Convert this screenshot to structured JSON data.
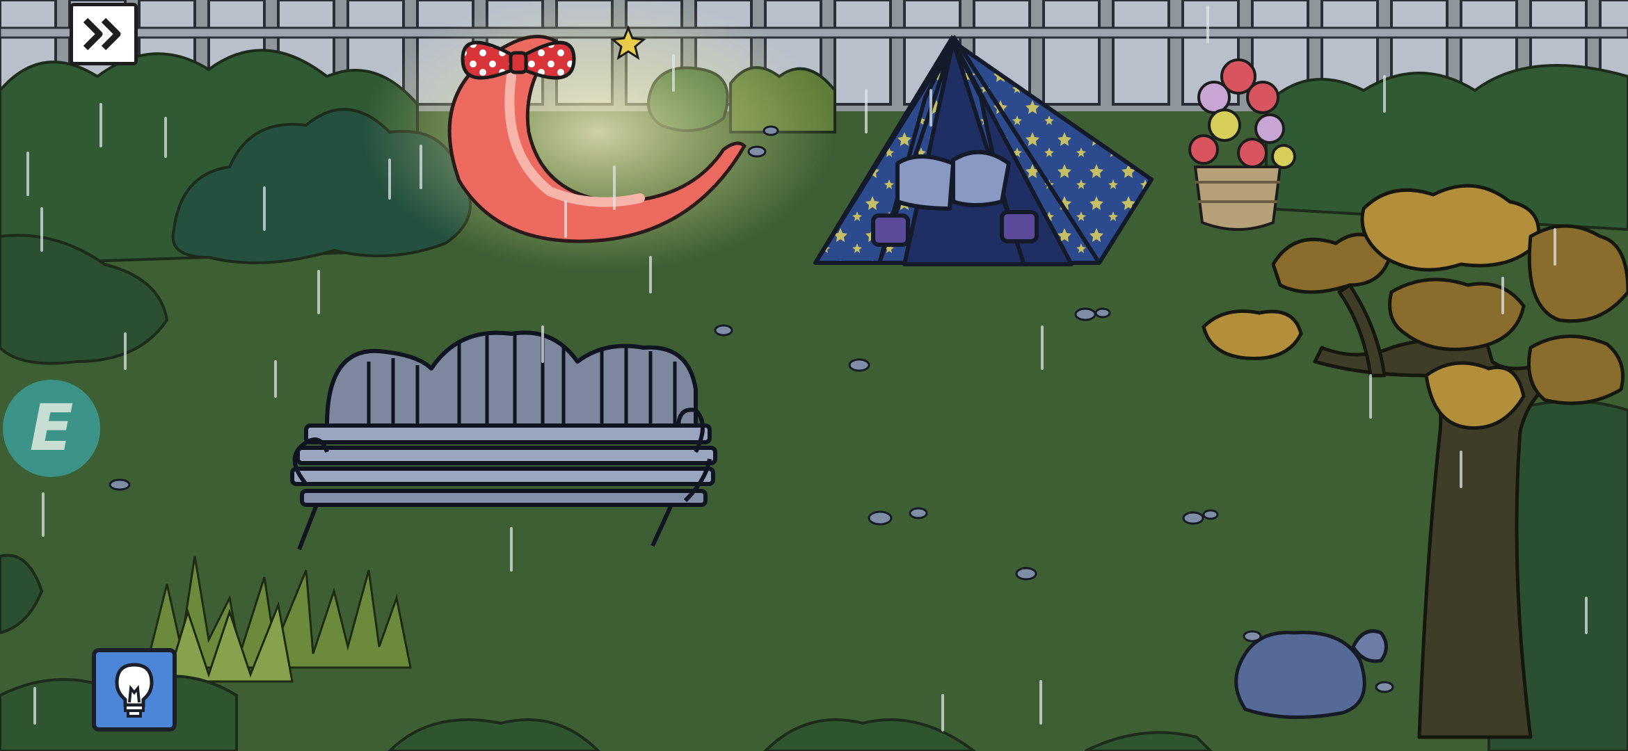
{
  "hud": {
    "skip_icon": "double-chevron-right-icon",
    "hint_icon": "lightbulb-icon",
    "badge_letter": "E"
  },
  "scene": {
    "weather": "rain",
    "objects": [
      "fence",
      "moon-lamp",
      "star-tent",
      "flower-basket",
      "bench",
      "autumn-tree",
      "rock",
      "grass-tuft",
      "bushes"
    ]
  },
  "colors": {
    "lawn": "#3e5f33",
    "fence": "#b9c0cc",
    "moon": "#ec6a5f",
    "tent": "#2c4b8e",
    "hint_button": "#4b86d8",
    "badge": "#3ca5a5"
  }
}
